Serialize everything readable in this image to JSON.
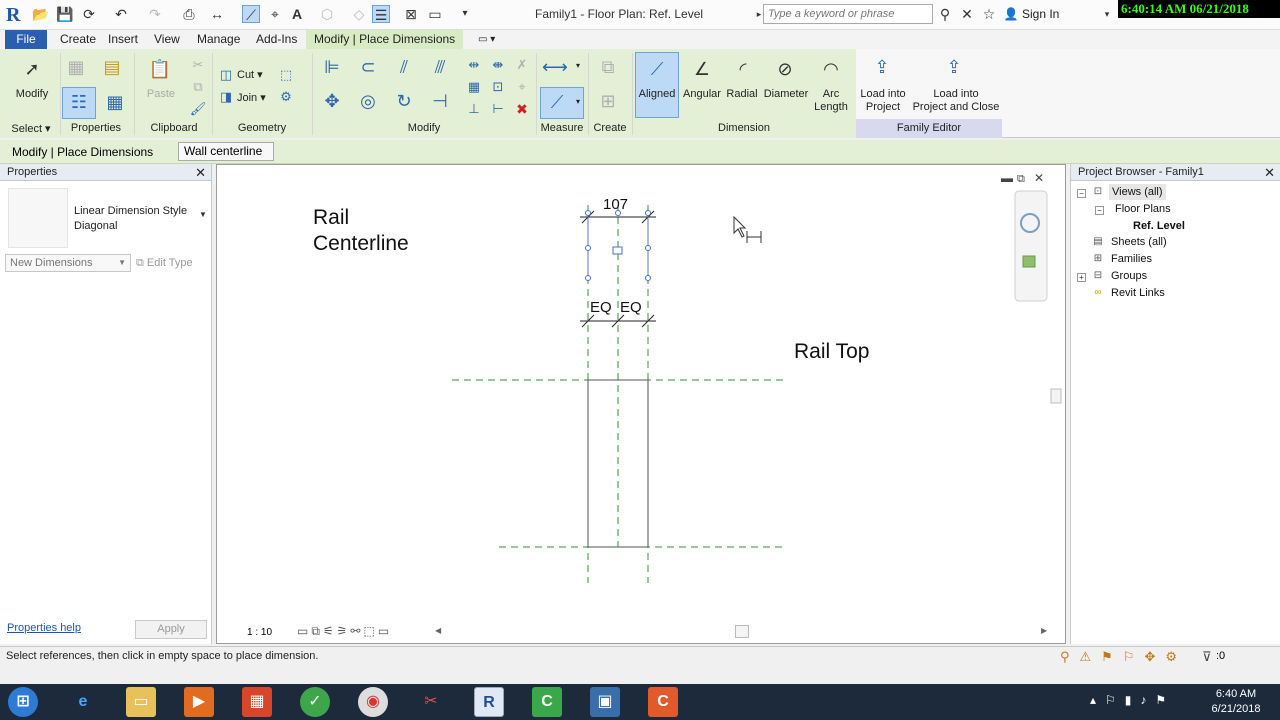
{
  "app": {
    "logo_letter": "R",
    "document_title": "Family1 - Floor Plan: Ref. Level",
    "search_placeholder": "Type a keyword or phrase",
    "sign_in": "Sign In",
    "clock_overlay": "6:40:14 AM 06/21/2018"
  },
  "tabs": [
    {
      "label": "File"
    },
    {
      "label": "Create"
    },
    {
      "label": "Insert"
    },
    {
      "label": "View"
    },
    {
      "label": "Manage"
    },
    {
      "label": "Add-Ins"
    },
    {
      "label": "Modify | Place Dimensions"
    }
  ],
  "ribbon": {
    "modify_label": "Modify",
    "paste_label": "Paste",
    "cut_label": "Cut",
    "join_label": "Join",
    "groups": {
      "select": "Select",
      "properties": "Properties",
      "clipboard": "Clipboard",
      "geometry": "Geometry",
      "modify": "Modify",
      "measure": "Measure",
      "create": "Create",
      "dimension": "Dimension",
      "family_editor": "Family Editor"
    },
    "dimension_tools": {
      "aligned": "Aligned",
      "angular": "Angular",
      "radial": "Radial",
      "diameter": "Diameter",
      "arc_length_1": "Arc",
      "arc_length_2": "Length"
    },
    "family_editor_tools": {
      "load_project_1": "Load into",
      "load_project_2": "Project",
      "load_close_1": "Load into",
      "load_close_2": "Project and Close"
    }
  },
  "options_bar": {
    "context_title": "Modify | Place Dimensions",
    "placement": "Wall centerline"
  },
  "properties": {
    "title": "Properties",
    "type_name": "Linear Dimension Style Diagonal",
    "instance_selector": "New Dimensions",
    "edit_type": "Edit Type",
    "help_link": "Properties help",
    "apply": "Apply"
  },
  "canvas": {
    "label_rail_centerline_1": "Rail",
    "label_rail_centerline_2": "Centerline",
    "label_rail_top": "Rail Top",
    "dim_value": "107",
    "eq_1": "EQ",
    "eq_2": "EQ",
    "scale": "1 : 10",
    "ref_line_color": "#3a8f3a"
  },
  "project_browser": {
    "title": "Project Browser - Family1",
    "items": [
      {
        "label": "Views (all)"
      },
      {
        "label": "Floor Plans"
      },
      {
        "label": "Ref. Level"
      },
      {
        "label": "Sheets (all)"
      },
      {
        "label": "Families"
      },
      {
        "label": "Groups"
      },
      {
        "label": "Revit Links"
      }
    ]
  },
  "status": {
    "message": "Select references, then click in empty space to place dimension.",
    "filter_count": ":0"
  },
  "taskbar": {
    "time": "6:40 AM",
    "date": "6/21/2018"
  },
  "colors": {
    "file_tab": "#2a5fb0",
    "context_tab": "#d8ecc3",
    "clock_text": "#39ff14"
  }
}
